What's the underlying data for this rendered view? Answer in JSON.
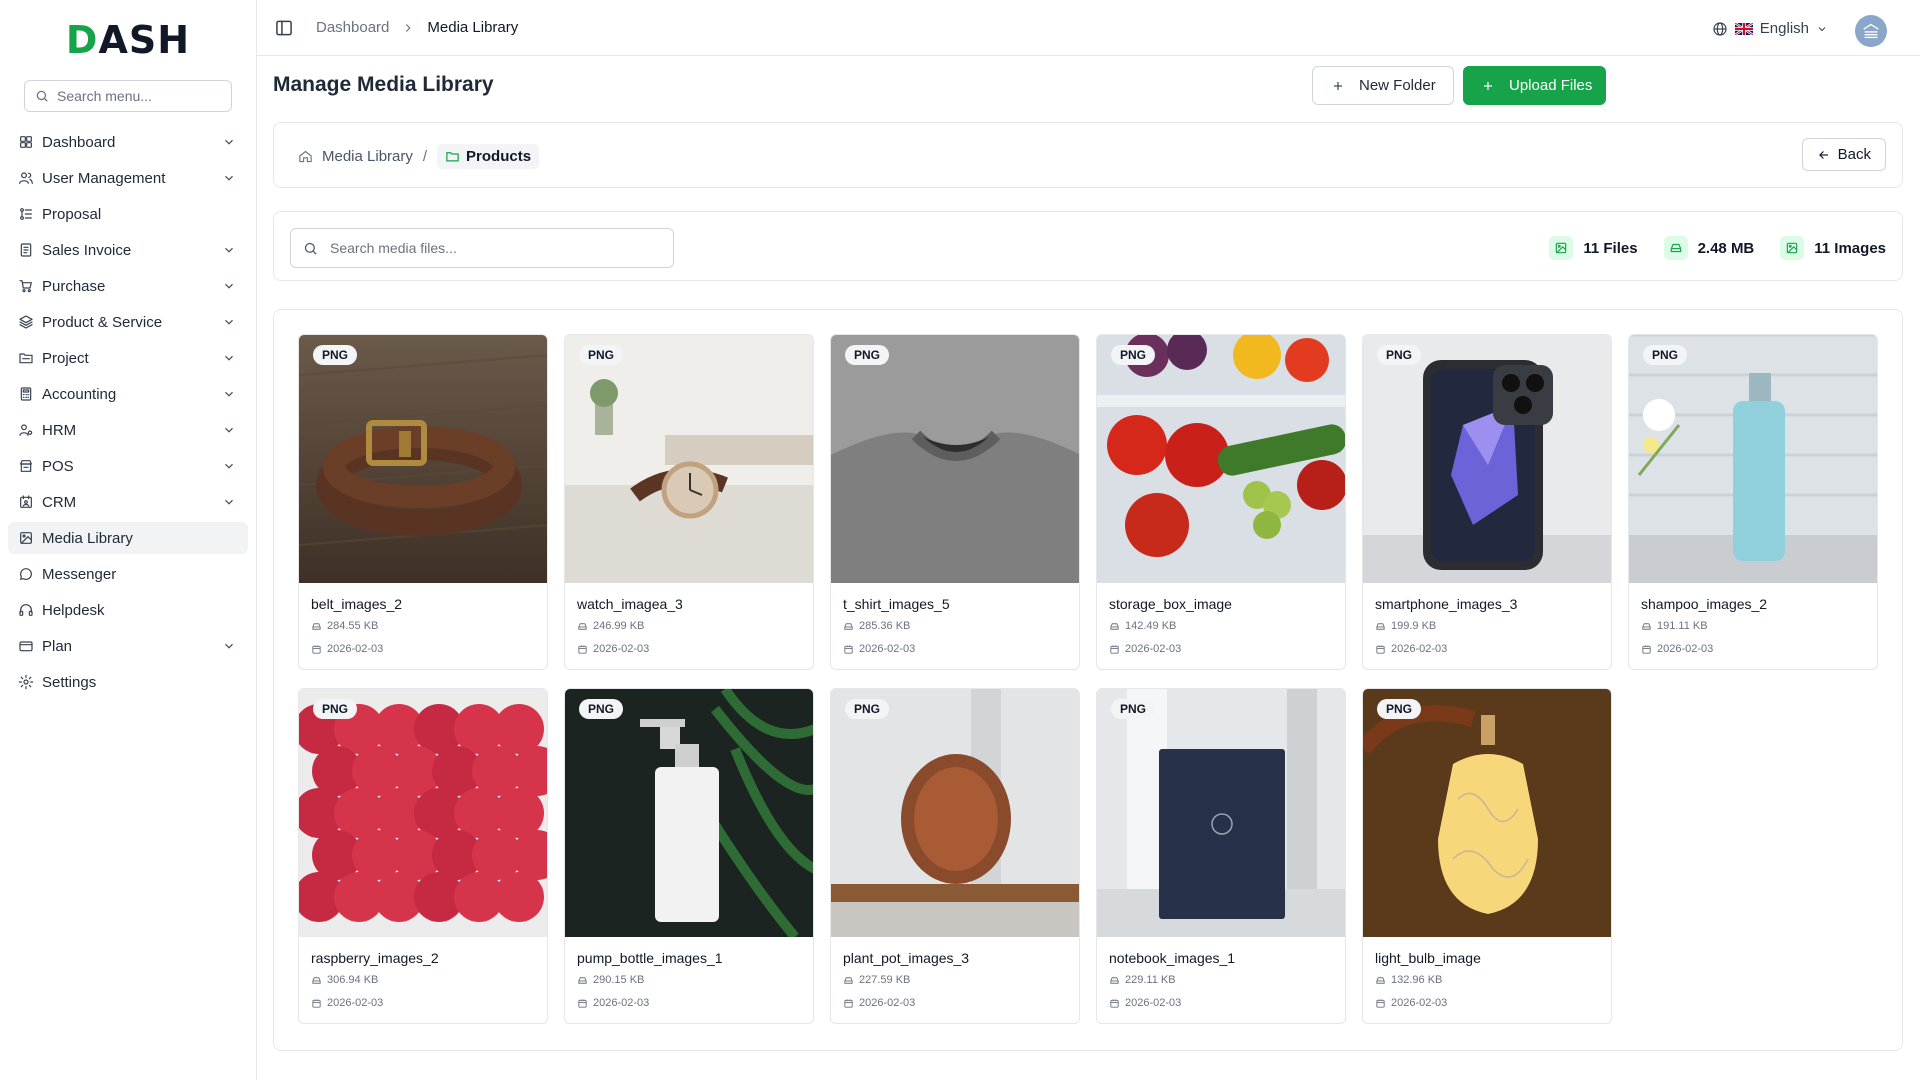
{
  "brand": {
    "logo_text": "DASH",
    "accent": "#16a34a"
  },
  "sidebar": {
    "search_placeholder": "Search menu...",
    "items": [
      {
        "label": "Dashboard",
        "icon": "grid-icon",
        "expandable": true
      },
      {
        "label": "User Management",
        "icon": "users-icon",
        "expandable": true
      },
      {
        "label": "Proposal",
        "icon": "proposal-icon",
        "expandable": false
      },
      {
        "label": "Sales Invoice",
        "icon": "invoice-icon",
        "expandable": true
      },
      {
        "label": "Purchase",
        "icon": "cart-icon",
        "expandable": true
      },
      {
        "label": "Product & Service",
        "icon": "layers-icon",
        "expandable": true
      },
      {
        "label": "Project",
        "icon": "folder-icon",
        "expandable": true
      },
      {
        "label": "Accounting",
        "icon": "calculator-icon",
        "expandable": true
      },
      {
        "label": "HRM",
        "icon": "hrm-icon",
        "expandable": true
      },
      {
        "label": "POS",
        "icon": "pos-icon",
        "expandable": true
      },
      {
        "label": "CRM",
        "icon": "crm-icon",
        "expandable": true
      },
      {
        "label": "Media Library",
        "icon": "image-icon",
        "expandable": false,
        "active": true
      },
      {
        "label": "Messenger",
        "icon": "chat-icon",
        "expandable": false
      },
      {
        "label": "Helpdesk",
        "icon": "headset-icon",
        "expandable": false
      },
      {
        "label": "Plan",
        "icon": "plan-icon",
        "expandable": true
      },
      {
        "label": "Settings",
        "icon": "gear-icon",
        "expandable": false
      }
    ]
  },
  "topbar": {
    "breadcrumb": [
      "Dashboard",
      "Media Library"
    ],
    "language": "English"
  },
  "page": {
    "title": "Manage Media Library",
    "new_folder_label": "New Folder",
    "upload_label": "Upload Files"
  },
  "folder_nav": {
    "root": "Media Library",
    "separator": "/",
    "current": "Products",
    "back_label": "Back"
  },
  "toolbar": {
    "search_placeholder": "Search media files...",
    "files_count": "11 Files",
    "total_size": "2.48 MB",
    "images_count": "11 Images"
  },
  "media": [
    {
      "name": "belt_images_2",
      "type": "PNG",
      "size": "284.55 KB",
      "date": "2026-02-03",
      "thumb": "belt"
    },
    {
      "name": "watch_imagea_3",
      "type": "PNG",
      "size": "246.99 KB",
      "date": "2026-02-03",
      "thumb": "watch"
    },
    {
      "name": "t_shirt_images_5",
      "type": "PNG",
      "size": "285.36 KB",
      "date": "2026-02-03",
      "thumb": "tshirt"
    },
    {
      "name": "storage_box_image",
      "type": "PNG",
      "size": "142.49 KB",
      "date": "2026-02-03",
      "thumb": "storage"
    },
    {
      "name": "smartphone_images_3",
      "type": "PNG",
      "size": "199.9 KB",
      "date": "2026-02-03",
      "thumb": "phone"
    },
    {
      "name": "shampoo_images_2",
      "type": "PNG",
      "size": "191.11 KB",
      "date": "2026-02-03",
      "thumb": "shampoo"
    },
    {
      "name": "raspberry_images_2",
      "type": "PNG",
      "size": "306.94 KB",
      "date": "2026-02-03",
      "thumb": "raspberry"
    },
    {
      "name": "pump_bottle_images_1",
      "type": "PNG",
      "size": "290.15 KB",
      "date": "2026-02-03",
      "thumb": "pump"
    },
    {
      "name": "plant_pot_images_3",
      "type": "PNG",
      "size": "227.59 KB",
      "date": "2026-02-03",
      "thumb": "pot"
    },
    {
      "name": "notebook_images_1",
      "type": "PNG",
      "size": "229.11 KB",
      "date": "2026-02-03",
      "thumb": "notebook"
    },
    {
      "name": "light_bulb_image",
      "type": "PNG",
      "size": "132.96 KB",
      "date": "2026-02-03",
      "thumb": "lamp"
    }
  ]
}
